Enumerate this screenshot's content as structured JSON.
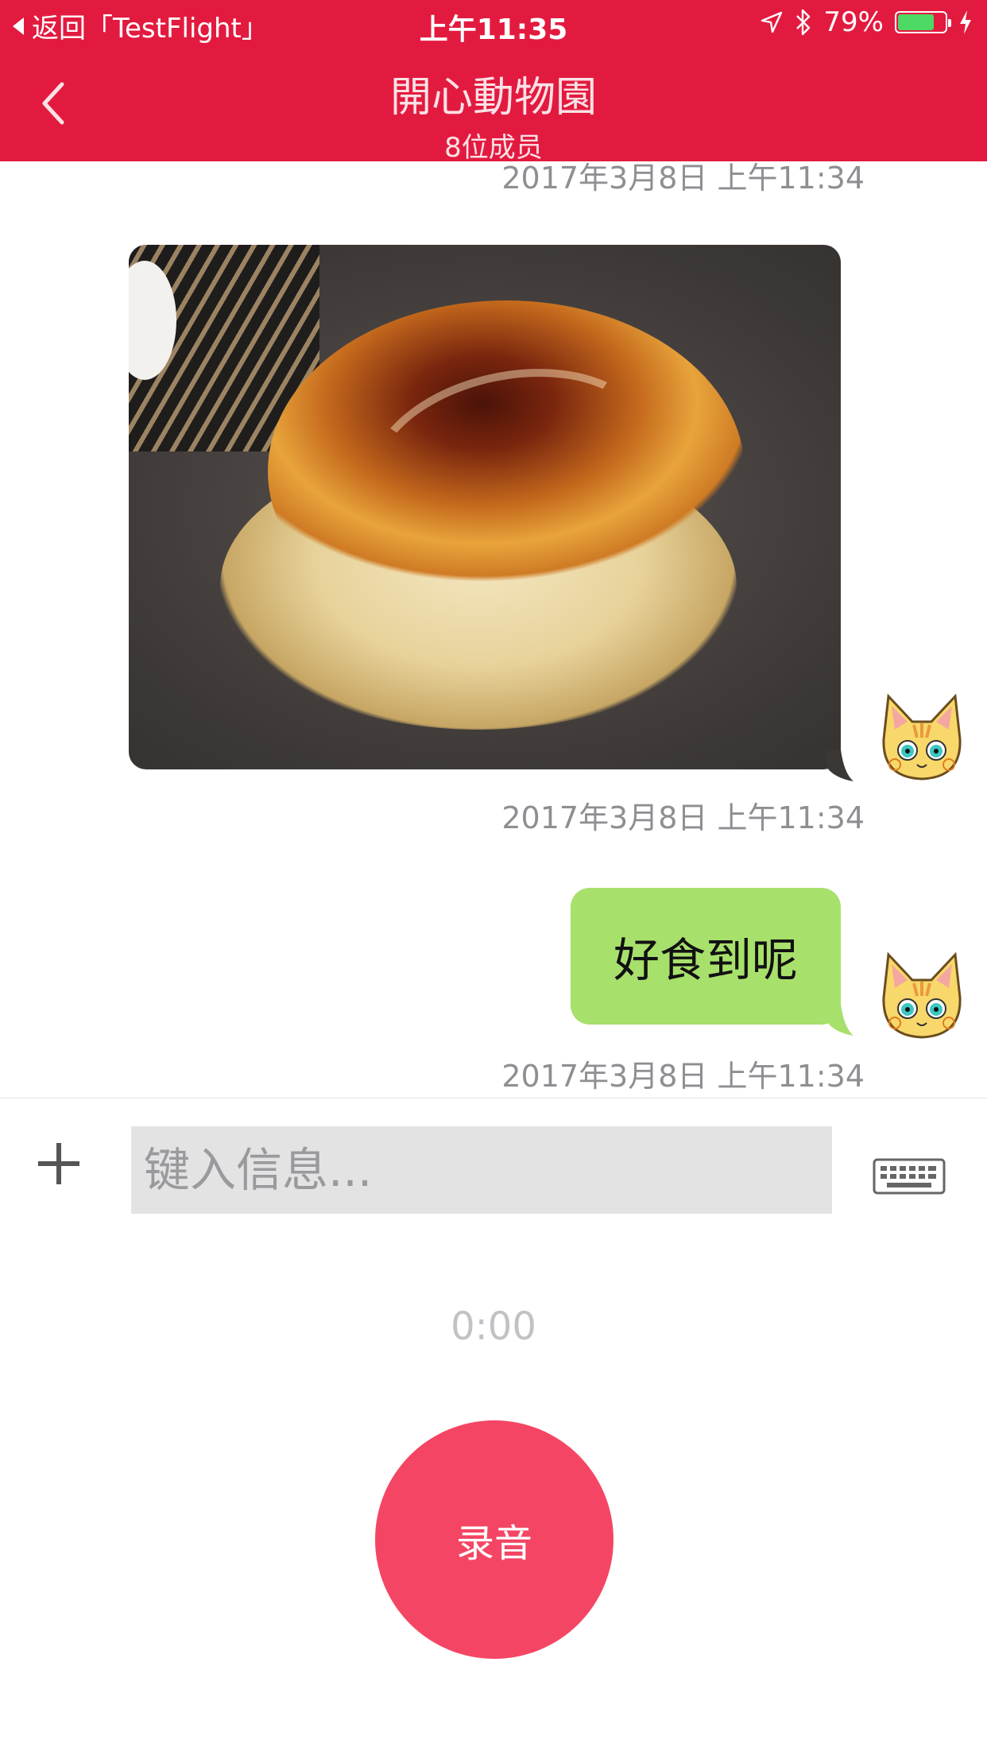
{
  "status_bar": {
    "back_app": "返回「TestFlight」",
    "time": "上午11:35",
    "battery_text": "79%",
    "battery_level": 0.79,
    "icons": [
      "location-icon",
      "bluetooth-icon",
      "battery-icon",
      "charging-icon"
    ]
  },
  "nav": {
    "back_icon": "chevron-left-icon",
    "title": "開心動物園",
    "subtitle": "8位成员"
  },
  "messages": [
    {
      "type": "timestamp",
      "text": "2017年3月8日 上午11:34"
    },
    {
      "type": "image",
      "description_icon": "photo",
      "sender": "self",
      "avatar": "cat-avatar"
    },
    {
      "type": "timestamp",
      "text": "2017年3月8日 上午11:34"
    },
    {
      "type": "text",
      "sender": "self",
      "text": "好食到呢",
      "avatar": "cat-avatar"
    },
    {
      "type": "timestamp",
      "text": "2017年3月8日 上午11:34"
    }
  ],
  "input_bar": {
    "plus_icon": "plus-icon",
    "placeholder": "键入信息...",
    "value": "",
    "keyboard_icon": "keyboard-icon"
  },
  "recorder": {
    "elapsed": "0:00",
    "button_label": "录音"
  },
  "colors": {
    "header": "#e31a3f",
    "bubble_self": "#a8e06c",
    "record_button": "#f44664",
    "timestamp": "#8e8e93"
  }
}
